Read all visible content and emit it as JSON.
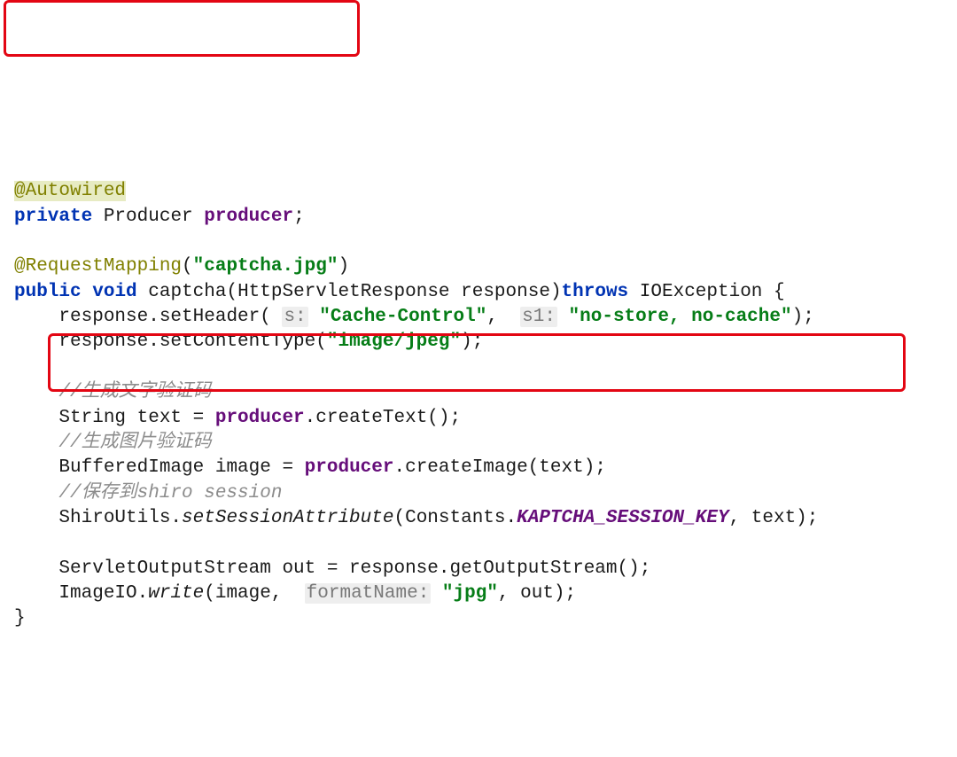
{
  "line1": {
    "ann": "@Autowired"
  },
  "line2": {
    "kw1": "private",
    "type": "Producer",
    "field": "producer",
    "semi": ";"
  },
  "line3": {
    "ann": "@RequestMapping",
    "p1": "(",
    "str": "\"captcha.jpg\"",
    "p2": ")"
  },
  "line4": {
    "kw1": "public",
    "kw2": "void",
    "name": "captcha(HttpServletResponse response)",
    "kw3": "throws",
    "rest": "IOException {"
  },
  "line5": {
    "a": "    response.setHeader( ",
    "h1": "s:",
    "sp1": " ",
    "s1": "\"Cache-Control\"",
    "c": ",  ",
    "h2": "s1:",
    "sp2": " ",
    "s2": "\"no-store, no-cache\"",
    "e": ");"
  },
  "line6": {
    "a": "    response.setContentType(",
    "s": "\"image/jpeg\"",
    "e": ");"
  },
  "line7": {
    "c": "    //生成文字验证码"
  },
  "line8": {
    "a": "    String text = ",
    "f": "producer",
    "b": ".createText();"
  },
  "line9": {
    "c": "    //生成图片验证码"
  },
  "line10": {
    "a": "    BufferedImage image = ",
    "f": "producer",
    "b": ".createImage(text);"
  },
  "line11": {
    "c": "    //保存到shiro session"
  },
  "line12": {
    "a": "    ShiroUtils.",
    "m": "setSessionAttribute",
    "b": "(Constants.",
    "k": "KAPTCHA_SESSION_KEY",
    "e": ", text);"
  },
  "line13": {
    "a": "    ServletOutputStream out = response.getOutputStream();"
  },
  "line14": {
    "a": "    ImageIO.",
    "m": "write",
    "b": "(image,  ",
    "h": "formatName:",
    "sp": " ",
    "s": "\"jpg\"",
    "e": ", out);"
  },
  "line15": {
    "a": "}"
  }
}
